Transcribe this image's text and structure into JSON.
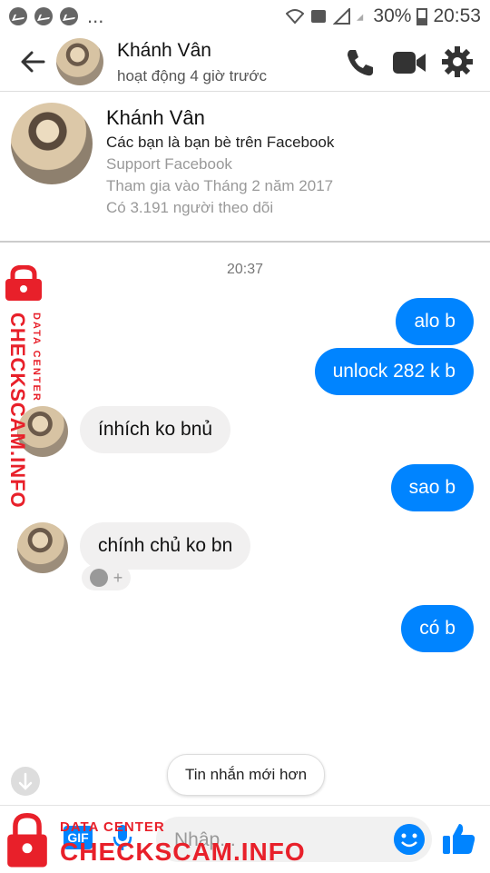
{
  "status_bar": {
    "battery": "30%",
    "time": "20:53",
    "overflow": "..."
  },
  "header": {
    "name": "Khánh Vân",
    "status": "hoạt động 4 giờ trước"
  },
  "profile": {
    "name": "Khánh Vân",
    "friends_line": "Các bạn là bạn bè trên Facebook",
    "org": "Support Facebook",
    "joined": "Tham gia vào Tháng 2 năm 2017",
    "followers": "Có 3.191 người theo dõi"
  },
  "conversation": {
    "timestamp": "20:37",
    "messages": [
      {
        "direction": "outgoing",
        "text": "alo b"
      },
      {
        "direction": "outgoing",
        "text": "unlock 282 k b"
      },
      {
        "direction": "incoming",
        "text": "ínhích ko bnủ"
      },
      {
        "direction": "outgoing",
        "text": "sao b"
      },
      {
        "direction": "incoming",
        "text": "chính chủ ko bn"
      },
      {
        "direction": "outgoing",
        "text": "có b"
      }
    ],
    "reaction_add": "+"
  },
  "newer_messages_label": "Tin nhắn mới hơn",
  "composer": {
    "placeholder": "Nhập...",
    "gif_label": "GIF"
  },
  "watermark": {
    "small": "DATA CENTER",
    "large": "CHECKSCAM.INFO"
  },
  "colors": {
    "accent": "#0084ff",
    "incoming_bubble": "#f1f0f0",
    "watermark": "#e8202a"
  }
}
